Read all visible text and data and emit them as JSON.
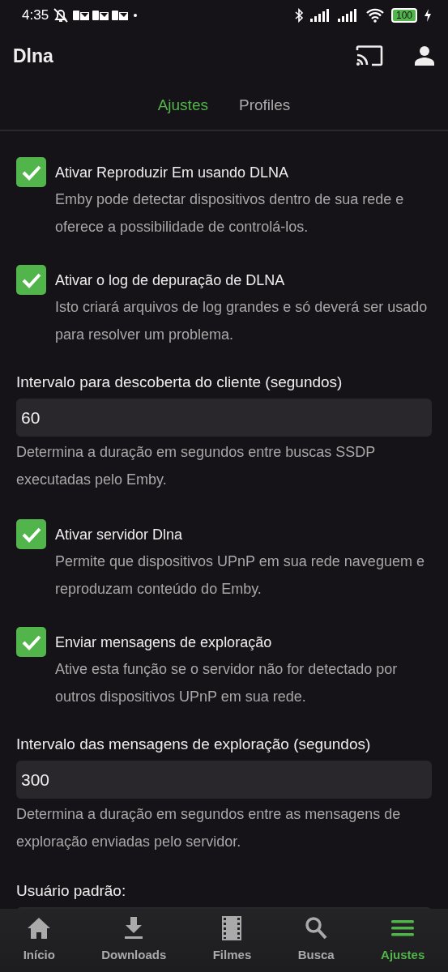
{
  "status_bar": {
    "time": "4:35",
    "battery": "100"
  },
  "header": {
    "title": "Dlna"
  },
  "tabs": [
    {
      "label": "Ajustes",
      "selected": true
    },
    {
      "label": "Profiles",
      "selected": false
    }
  ],
  "settings": [
    {
      "kind": "checkbox",
      "label": "Ativar Reproduzir Em usando DLNA",
      "checked": true,
      "description": "Emby pode detectar dispositivos dentro de sua rede e oferece a possibilidade de controlá-los."
    },
    {
      "kind": "checkbox",
      "label": "Ativar o log de depuração de DLNA",
      "checked": true,
      "description": "Isto criará arquivos de log grandes e só deverá ser usado para resolver um problema."
    },
    {
      "kind": "field",
      "label": "Intervalo para descoberta do cliente (segundos)",
      "value": "60",
      "description": "Determina a duração em segundos entre buscas SSDP executadas pelo Emby."
    },
    {
      "kind": "checkbox",
      "label": "Ativar servidor Dlna",
      "checked": true,
      "description": "Permite que dispositivos UPnP em sua rede naveguem e reproduzam conteúdo do Emby."
    },
    {
      "kind": "checkbox",
      "label": "Enviar mensagens de exploração",
      "checked": true,
      "description": "Ative esta função se o servidor não for detectado por outros dispositivos UPnP em sua rede."
    },
    {
      "kind": "field",
      "label": "Intervalo das mensagens de exploração (segundos)",
      "value": "300",
      "description": "Determina a duração em segundos entre as mensagens de exploração enviadas pelo servidor."
    },
    {
      "kind": "field",
      "label": "Usuário padrão:"
    }
  ],
  "nav": [
    {
      "label": "Início",
      "selected": false
    },
    {
      "label": "Downloads",
      "selected": false
    },
    {
      "label": "Filmes",
      "selected": false
    },
    {
      "label": "Busca",
      "selected": false
    },
    {
      "label": "Ajustes",
      "selected": true
    }
  ]
}
